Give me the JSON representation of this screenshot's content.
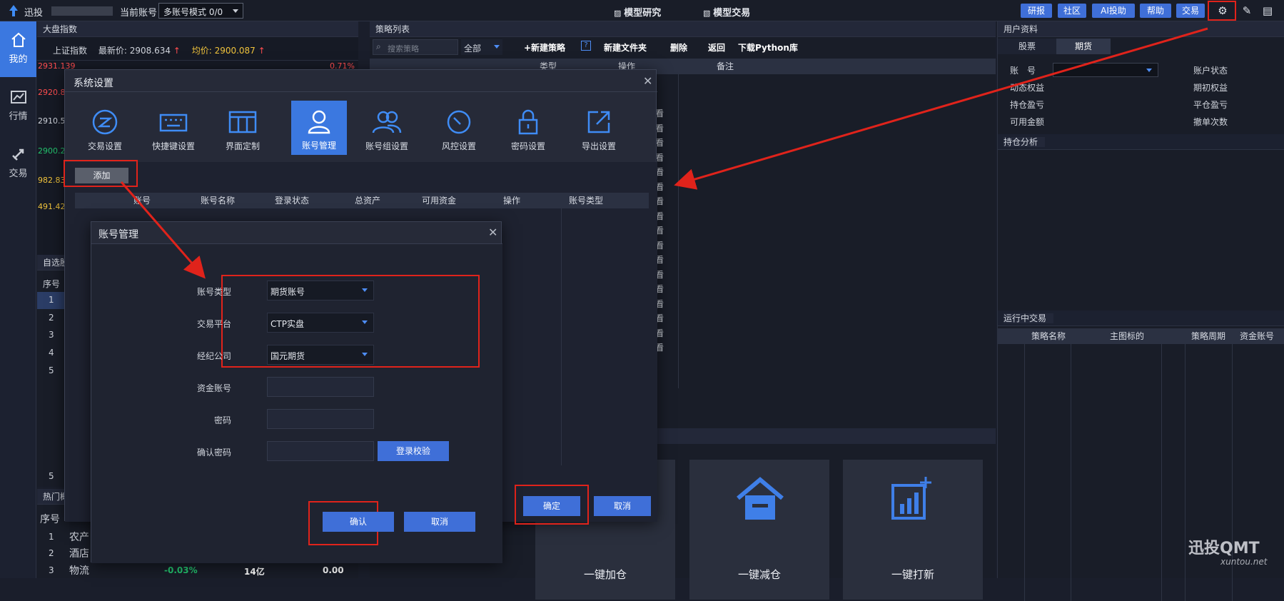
{
  "topbar": {
    "app_name": "迅投",
    "current_account_label": "当前账号",
    "account_mode": "多账号模式 0/0",
    "tab_model_research": "模型研究",
    "tab_model_trading": "模型交易",
    "buttons": [
      "研报",
      "社区",
      "AI投助",
      "帮助",
      "交易"
    ]
  },
  "leftnav": [
    "我的",
    "行情",
    "交易"
  ],
  "market": {
    "panel_title": "大盘指数",
    "index_name": "上证指数",
    "latest_label": "最新价:",
    "latest_value": "2908.634",
    "avg_label": "均价:",
    "avg_value": "2900.087",
    "prices": [
      "2931.139",
      "2920.84",
      "2910.54",
      "2900.24",
      "982.83",
      "491.42"
    ],
    "pct": "0.71%"
  },
  "watchlist": {
    "title": "自选股",
    "col_seq": "序号",
    "rows": [
      "1",
      "2",
      "3",
      "4",
      "5"
    ],
    "bottom_row": "5"
  },
  "hot": {
    "title": "热门概念",
    "col_seq": "序号",
    "rows": [
      {
        "n": "1",
        "name": "农产"
      },
      {
        "n": "2",
        "name": "酒店"
      },
      {
        "n": "3",
        "name": "物流",
        "pct": "-0.03%",
        "cap": "14亿",
        "val": "0.00"
      }
    ]
  },
  "strategy": {
    "title": "策略列表",
    "search_placeholder": "搜索策略",
    "filter": "全部",
    "actions": [
      "+新建策略",
      "新建文件夹",
      "删除",
      "返回",
      "下载Python库"
    ],
    "help": "?",
    "cols": [
      "类型",
      "操作",
      "备注"
    ],
    "view": "看"
  },
  "bigcards": [
    "一键加仓",
    "一键减仓",
    "一键打新"
  ],
  "userinfo": {
    "title": "用户资料",
    "tabs": [
      "股票",
      "期货"
    ],
    "fields_left": [
      "账　号",
      "动态权益",
      "持仓盈亏",
      "可用金额"
    ],
    "fields_right": [
      "账户状态",
      "期初权益",
      "平仓盈亏",
      "撤单次数"
    ],
    "position_title": "持仓分析",
    "running_title": "运行中交易",
    "running_cols": [
      "策略名称",
      "主图标的",
      "策略周期",
      "资金账号"
    ]
  },
  "settings": {
    "title": "系统设置",
    "icons": [
      "交易设置",
      "快捷键设置",
      "界面定制",
      "账号管理",
      "账号组设置",
      "风控设置",
      "密码设置",
      "导出设置"
    ],
    "add_btn": "添加",
    "cols": [
      "账号",
      "账号名称",
      "登录状态",
      "总资产",
      "可用资金",
      "操作",
      "账号类型"
    ],
    "ok": "确定",
    "cancel": "取消"
  },
  "acct": {
    "title": "账号管理",
    "type_label": "账号类型",
    "type_value": "期货账号",
    "platform_label": "交易平台",
    "platform_value": "CTP实盘",
    "broker_label": "经纪公司",
    "broker_value": "国元期货",
    "fund_label": "资金账号",
    "pwd_label": "密码",
    "confirm_pwd_label": "确认密码",
    "verify_btn": "登录校验",
    "confirm_btn": "确认",
    "cancel_btn": "取消"
  },
  "watermark": {
    "brand": "迅投QMT",
    "url": "xuntou.net"
  },
  "colors": {
    "accent": "#3f6fd8",
    "highlight": "#e0231b",
    "up": "#ff4d4f",
    "down": "#23c46e"
  }
}
